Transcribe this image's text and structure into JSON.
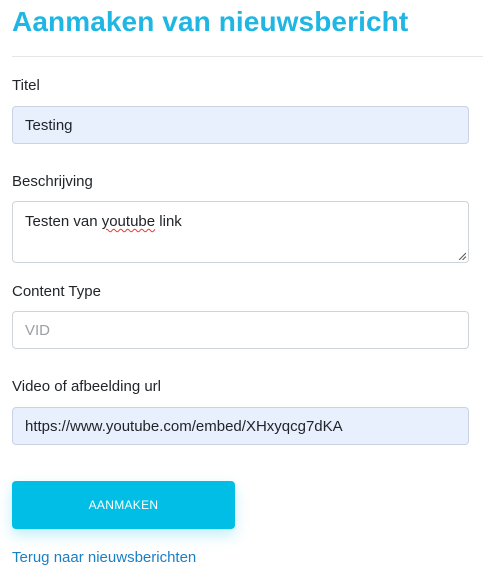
{
  "page": {
    "title": "Aanmaken van nieuwsbericht"
  },
  "form": {
    "titel": {
      "label": "Titel",
      "value": "Testing"
    },
    "beschrijving": {
      "label": "Beschrijving",
      "value_before": "Testen van ",
      "value_misspelled": "youtube",
      "value_after": " link"
    },
    "content_type": {
      "label": "Content Type",
      "placeholder": "VID"
    },
    "media_url": {
      "label": "Video of afbeelding url",
      "value": "https://www.youtube.com/embed/XHxyqcg7dKA"
    }
  },
  "actions": {
    "submit_label": "AANMAKEN",
    "back_link": "Terug naar nieuwsberichten"
  },
  "colors": {
    "accent": "#1fb6e4",
    "button": "#00bee6",
    "link": "#1b7fc4",
    "autofill": "#e8f0fe"
  }
}
